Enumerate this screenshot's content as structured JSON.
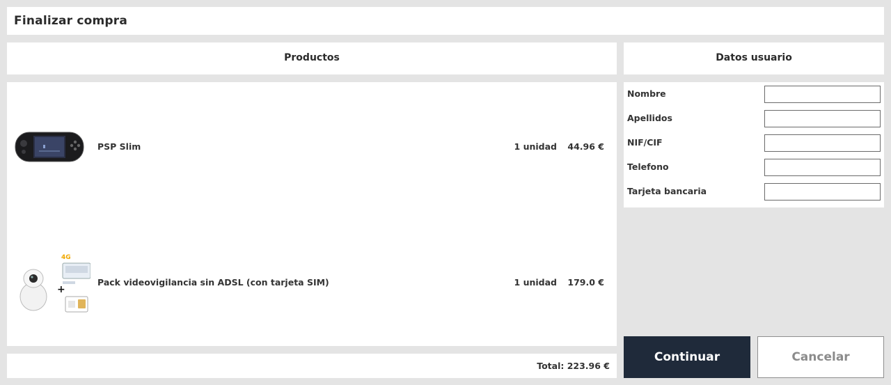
{
  "page": {
    "title": "Finalizar compra"
  },
  "products": {
    "header": "Productos",
    "items": [
      {
        "name": "PSP Slim",
        "quantity": "1 unidad",
        "price": "44.96 €",
        "image": "psp-console-icon"
      },
      {
        "name": "Pack videovigilancia sin ADSL (con tarjeta SIM)",
        "quantity": "1 unidad",
        "price": "179.0 €",
        "image": "camera-router-sim-icon",
        "image_text": {
          "badge": "4G",
          "plus": "+"
        }
      }
    ],
    "total": "Total: 223.96 €"
  },
  "user": {
    "header": "Datos usuario",
    "fields": [
      {
        "label": "Nombre",
        "value": ""
      },
      {
        "label": "Apellidos",
        "value": ""
      },
      {
        "label": "NIF/CIF",
        "value": ""
      },
      {
        "label": "Telefono",
        "value": ""
      },
      {
        "label": "Tarjeta bancaria",
        "value": ""
      }
    ]
  },
  "actions": {
    "continue": "Continuar",
    "cancel": "Cancelar"
  },
  "colors": {
    "primary_button": "#1f2a3a",
    "background": "#e4e4e4",
    "panel": "#ffffff"
  }
}
